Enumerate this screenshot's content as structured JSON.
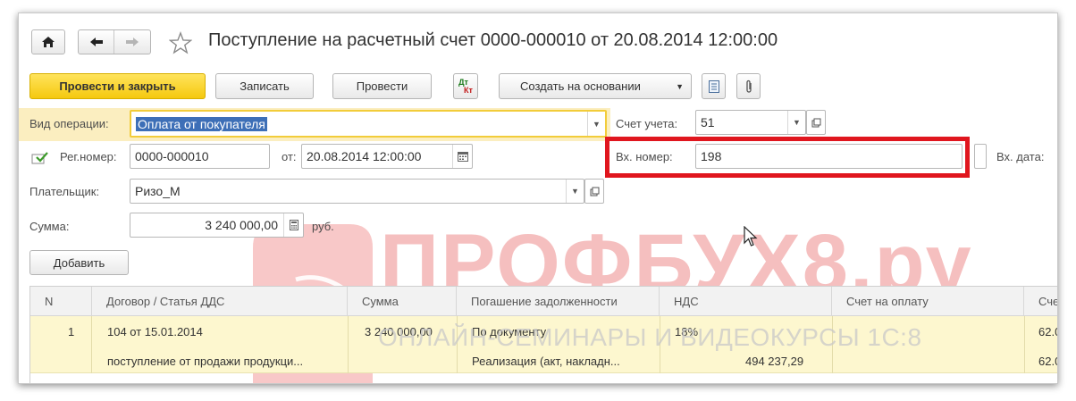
{
  "window": {
    "title": "Поступление на расчетный счет 0000-000010 от 20.08.2014 12:00:00"
  },
  "toolbar": {
    "post_close": "Провести и закрыть",
    "save": "Записать",
    "post": "Провести",
    "dtkt_top": "Дт",
    "dtkt_bottom": "Кт",
    "create_based": "Создать на основании"
  },
  "form": {
    "operation_label": "Вид операции:",
    "operation_value": "Оплата от покупателя",
    "account_label": "Счет учета:",
    "account_value": "51",
    "reg_label": "Рег.номер:",
    "reg_value": "0000-000010",
    "from_label": "от:",
    "from_value": "20.08.2014 12:00:00",
    "in_number_label": "Вх. номер:",
    "in_number_value": "198",
    "in_date_label": "Вх. дата:",
    "payer_label": "Плательщик:",
    "payer_value": "Ризо_М",
    "sum_label": "Сумма:",
    "sum_value": "3 240 000,00",
    "currency": "руб.",
    "add_button": "Добавить"
  },
  "table": {
    "columns": [
      "N",
      "Договор / Статья ДДС",
      "Сумма",
      "Погашение задолженности",
      "НДС",
      "Счет на оплату",
      "Счет"
    ],
    "rows": [
      {
        "n": "1",
        "contract": "104 от 15.01.2014",
        "article": "поступление от продажи продукци...",
        "sum": "3 240 000,00",
        "repayment": "По документу",
        "document": "Реализация (акт, накладн...",
        "vat_rate": "18%",
        "vat_sum": "494 237,29",
        "account_top": "62.0",
        "account_bottom": "62.0"
      }
    ]
  },
  "watermark": {
    "main": "ПРОФБУХ8.ру",
    "sub": "ОНЛАЙН-СЕМИНАРЫ И ВИДЕОКУРСЫ 1С:8"
  },
  "colors": {
    "accent_yellow": "#f5c90f",
    "highlight_red": "#e0161e",
    "row_yellow": "#fdf7cf",
    "watermark": "#f2a5a5"
  }
}
